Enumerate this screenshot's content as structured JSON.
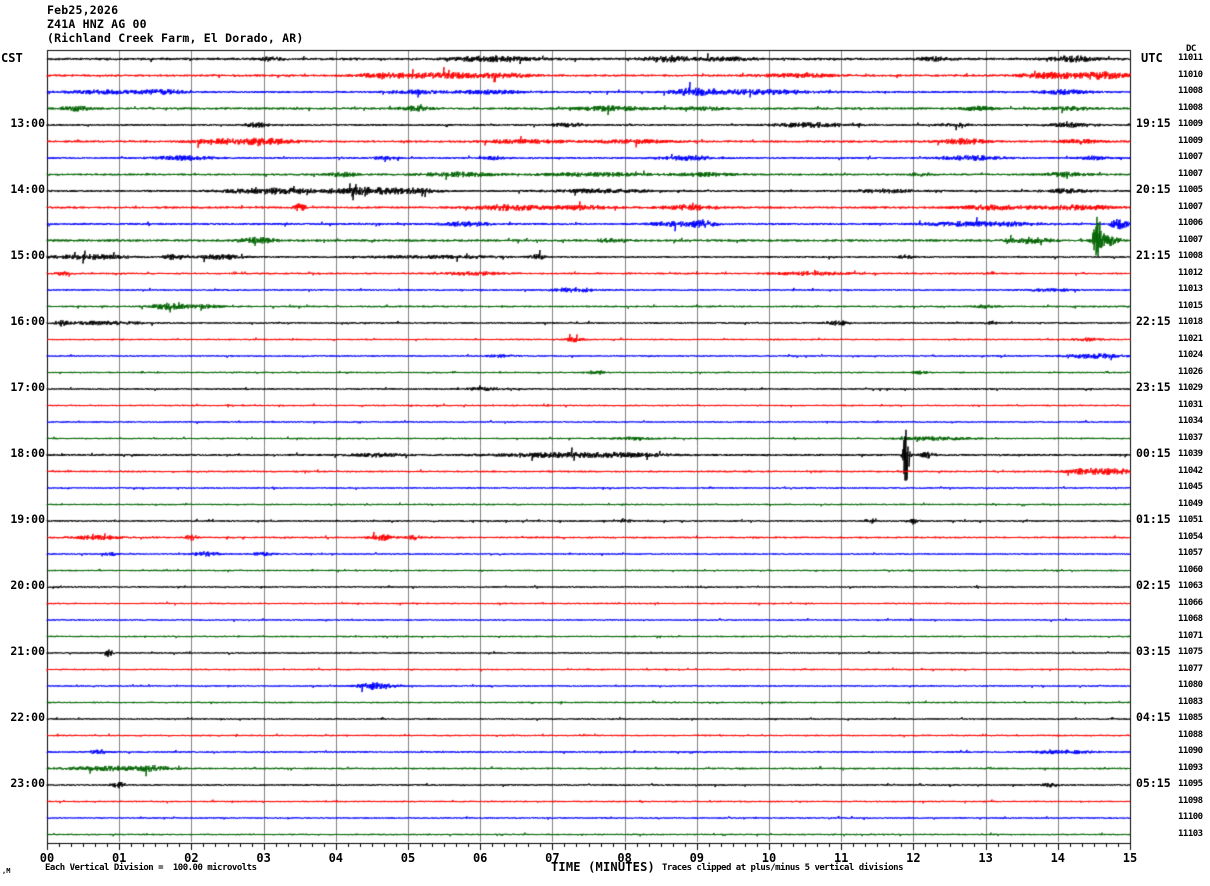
{
  "header": {
    "date": "Feb25,2026",
    "station": "Z41A HNZ AG 00",
    "location": "(Richland Creek Farm, El Dorado, AR)"
  },
  "axes": {
    "left_label": "CST",
    "right_label": "UTC",
    "dc_label": "DC",
    "x_title": "TIME (MINUTES)",
    "x_ticks": [
      "00",
      "01",
      "02",
      "03",
      "04",
      "05",
      "06",
      "07",
      "08",
      "09",
      "10",
      "11",
      "12",
      "13",
      "14",
      "15"
    ]
  },
  "footer": {
    "scale_note": "Each Vertical Division =  100.00 microvolts",
    "clip_note": "Traces clipped at plus/minus 5 vertical divisions",
    "corner_mark": ",M"
  },
  "colors": {
    "background": "#ffffff",
    "grid": "#808080",
    "border": "#000000",
    "text": "#000000",
    "trace_map": {
      "black": "#000000",
      "red": "#ff0000",
      "blue": "#0000ff",
      "green": "#006400"
    }
  },
  "chart_data": {
    "type": "line",
    "subtype": "helicorder-seismogram",
    "title": "Feb25,2026 Z41A HNZ AG 00 (Richland Creek Farm, El Dorado, AR)",
    "xlabel": "TIME (MINUTES)",
    "x_range_minutes": [
      0,
      15
    ],
    "x_major_tick_minutes": 1,
    "x_minor_tick_seconds": 10,
    "minutes_per_row": 15,
    "left_timezone": "CST",
    "right_timezone": "UTC",
    "vertical_division_microvolts": 100.0,
    "clip_divisions": 5,
    "grid": "vertical-minute-lines",
    "trace_color_cycle": [
      "black",
      "red",
      "blue",
      "green"
    ],
    "rows": [
      {
        "color": "black",
        "dc": 11011,
        "base": 1.3,
        "events": [
          [
            3.1,
            1.5,
            0.15
          ],
          [
            6.2,
            2.5,
            0.5
          ],
          [
            8.6,
            2.5,
            0.3
          ],
          [
            9.4,
            1.5,
            0.4
          ],
          [
            12.3,
            1.5,
            0.2
          ],
          [
            14.2,
            2.5,
            0.3
          ]
        ]
      },
      {
        "color": "red",
        "dc": 11010,
        "base": 1.1,
        "events": [
          [
            4.7,
            2,
            0.4
          ],
          [
            5.6,
            2.5,
            0.6
          ],
          [
            6.4,
            1.5,
            0.3
          ],
          [
            10.4,
            1.5,
            0.5
          ],
          [
            13.9,
            2.5,
            0.4
          ],
          [
            14.6,
            3,
            0.4
          ]
        ]
      },
      {
        "color": "blue",
        "dc": 11008,
        "base": 1.1,
        "events": [
          [
            0.8,
            1.5,
            0.5
          ],
          [
            1.6,
            2,
            0.3
          ],
          [
            5.1,
            1.5,
            0.3
          ],
          [
            6.1,
            1.5,
            0.5
          ],
          [
            8.9,
            3,
            0.25
          ],
          [
            9.8,
            2,
            0.8
          ],
          [
            14.1,
            2,
            0.3
          ]
        ]
      },
      {
        "color": "green",
        "dc": 11008,
        "base": 1.1,
        "events": [
          [
            0.4,
            2,
            0.2
          ],
          [
            5.1,
            2,
            0.2
          ],
          [
            7.8,
            2,
            0.5
          ],
          [
            9.1,
            1.5,
            0.3
          ],
          [
            12.9,
            2,
            0.2
          ],
          [
            14.2,
            1.5,
            0.3
          ]
        ]
      },
      {
        "cst": "13:00",
        "utc": "19:15",
        "color": "black",
        "dc": 11009,
        "base": 1.0,
        "events": [
          [
            2.9,
            2,
            0.15
          ],
          [
            7.2,
            1.5,
            0.2
          ],
          [
            10.6,
            2,
            0.5
          ],
          [
            12.6,
            1.5,
            0.2
          ],
          [
            14.2,
            2,
            0.3
          ]
        ]
      },
      {
        "color": "red",
        "dc": 11009,
        "base": 1.1,
        "events": [
          [
            2.3,
            2.5,
            0.3
          ],
          [
            3.0,
            3,
            0.4
          ],
          [
            6.6,
            1.5,
            0.6
          ],
          [
            8.1,
            1.5,
            0.5
          ],
          [
            12.7,
            2.5,
            0.3
          ],
          [
            14.3,
            2,
            0.25
          ]
        ]
      },
      {
        "color": "blue",
        "dc": 11007,
        "base": 1.0,
        "events": [
          [
            1.9,
            2,
            0.4
          ],
          [
            4.7,
            1.5,
            0.15
          ],
          [
            6.2,
            1.5,
            0.15
          ],
          [
            8.9,
            2,
            0.4
          ],
          [
            12.8,
            2,
            0.4
          ],
          [
            14.5,
            1.5,
            0.2
          ]
        ]
      },
      {
        "color": "green",
        "dc": 11007,
        "base": 1.0,
        "events": [
          [
            4.1,
            2,
            0.2
          ],
          [
            5.7,
            2,
            0.5
          ],
          [
            7.6,
            1.5,
            0.8
          ],
          [
            9.1,
            1.5,
            0.4
          ],
          [
            12.1,
            1.5,
            0.15
          ],
          [
            14.1,
            2,
            0.3
          ]
        ]
      },
      {
        "cst": "14:00",
        "utc": "20:15",
        "color": "black",
        "dc": 11005,
        "base": 1.1,
        "events": [
          [
            3.1,
            2.5,
            0.6
          ],
          [
            4.4,
            3,
            0.5
          ],
          [
            5.1,
            2,
            0.3
          ],
          [
            7.7,
            1.5,
            0.6
          ],
          [
            11.6,
            1.5,
            0.4
          ],
          [
            14.1,
            1.5,
            0.3
          ]
        ]
      },
      {
        "color": "red",
        "dc": 11007,
        "base": 1.1,
        "events": [
          [
            3.5,
            3.5,
            0.08
          ],
          [
            6.4,
            2.5,
            0.5
          ],
          [
            7.4,
            2,
            0.4
          ],
          [
            8.9,
            2,
            0.4
          ],
          [
            13.1,
            2,
            0.5
          ],
          [
            14.3,
            2,
            0.5
          ]
        ]
      },
      {
        "color": "blue",
        "dc": 11006,
        "base": 1.1,
        "events": [
          [
            5.8,
            2,
            0.3
          ],
          [
            8.7,
            2,
            0.3
          ],
          [
            9.1,
            3.5,
            0.15
          ],
          [
            12.7,
            2,
            0.5
          ],
          [
            13.4,
            1.5,
            0.3
          ],
          [
            14.85,
            4.5,
            0.12
          ]
        ]
      },
      {
        "color": "green",
        "dc": 11007,
        "base": 1.2,
        "events": [
          [
            2.9,
            2.5,
            0.25
          ],
          [
            7.8,
            1.5,
            0.2
          ],
          [
            13.6,
            2.5,
            0.3
          ],
          [
            14.55,
            22,
            0.06
          ],
          [
            14.7,
            5,
            0.15
          ]
        ]
      },
      {
        "cst": "15:00",
        "utc": "21:15",
        "color": "black",
        "dc": 11008,
        "base": 1.0,
        "events": [
          [
            0.6,
            2,
            0.5
          ],
          [
            1.75,
            3,
            0.12
          ],
          [
            2.4,
            2,
            0.3
          ],
          [
            5.4,
            1.2,
            0.8
          ],
          [
            6.8,
            2,
            0.1
          ],
          [
            11.9,
            1.5,
            0.1
          ]
        ]
      },
      {
        "color": "red",
        "dc": 11012,
        "base": 0.9,
        "events": [
          [
            0.2,
            2,
            0.1
          ],
          [
            5.9,
            1.5,
            0.4
          ],
          [
            10.6,
            1.5,
            0.5
          ]
        ]
      },
      {
        "color": "blue",
        "dc": 11013,
        "base": 0.9,
        "events": [
          [
            7.3,
            2,
            0.3
          ],
          [
            13.9,
            1.2,
            0.3
          ]
        ]
      },
      {
        "color": "green",
        "dc": 11015,
        "base": 0.9,
        "events": [
          [
            1.7,
            3,
            0.25
          ],
          [
            2.2,
            1.5,
            0.2
          ],
          [
            13.0,
            1.5,
            0.15
          ]
        ]
      },
      {
        "cst": "16:00",
        "utc": "22:15",
        "color": "black",
        "dc": 11018,
        "base": 0.9,
        "events": [
          [
            0.2,
            2.5,
            0.08
          ],
          [
            0.8,
            1.5,
            0.5
          ],
          [
            10.95,
            2,
            0.15
          ],
          [
            13.1,
            1.5,
            0.1
          ]
        ]
      },
      {
        "color": "red",
        "dc": 11021,
        "base": 0.8,
        "events": [
          [
            7.3,
            2,
            0.12
          ],
          [
            14.4,
            1.5,
            0.2
          ]
        ]
      },
      {
        "color": "blue",
        "dc": 11024,
        "base": 0.8,
        "events": [
          [
            6.3,
            1.2,
            0.2
          ],
          [
            14.5,
            2,
            0.4
          ]
        ]
      },
      {
        "color": "green",
        "dc": 11026,
        "base": 0.8,
        "events": [
          [
            7.6,
            2,
            0.12
          ],
          [
            12.1,
            1.5,
            0.1
          ]
        ]
      },
      {
        "cst": "17:00",
        "utc": "23:15",
        "color": "black",
        "dc": 11029,
        "base": 0.9,
        "events": [
          [
            6.1,
            1.2,
            0.3
          ]
        ]
      },
      {
        "color": "red",
        "dc": 11031,
        "base": 0.8,
        "events": []
      },
      {
        "color": "blue",
        "dc": 11034,
        "base": 0.8,
        "events": []
      },
      {
        "color": "green",
        "dc": 11037,
        "base": 0.8,
        "events": [
          [
            8.1,
            1.2,
            0.3
          ],
          [
            12.3,
            1.5,
            0.5
          ]
        ]
      },
      {
        "cst": "18:00",
        "utc": "00:15",
        "color": "black",
        "dc": 11039,
        "base": 1.1,
        "events": [
          [
            4.6,
            1.5,
            0.3
          ],
          [
            7.1,
            2,
            0.8
          ],
          [
            8.1,
            1.5,
            0.5
          ],
          [
            11.9,
            38,
            0.035
          ],
          [
            12.2,
            2.5,
            0.1
          ]
        ]
      },
      {
        "color": "red",
        "dc": 11042,
        "base": 0.9,
        "events": [
          [
            14.45,
            3,
            0.3
          ],
          [
            14.85,
            2,
            0.2
          ]
        ]
      },
      {
        "color": "blue",
        "dc": 11045,
        "base": 0.8,
        "events": []
      },
      {
        "color": "green",
        "dc": 11049,
        "base": 0.8,
        "events": []
      },
      {
        "cst": "19:00",
        "utc": "01:15",
        "color": "black",
        "dc": 11051,
        "base": 0.9,
        "events": [
          [
            8.0,
            2,
            0.08
          ],
          [
            11.4,
            2.5,
            0.06
          ],
          [
            12.0,
            2,
            0.08
          ]
        ]
      },
      {
        "color": "red",
        "dc": 11054,
        "base": 0.9,
        "events": [
          [
            0.7,
            2,
            0.3
          ],
          [
            2.0,
            2.5,
            0.08
          ],
          [
            4.65,
            3,
            0.15
          ],
          [
            5.1,
            2,
            0.1
          ]
        ]
      },
      {
        "color": "blue",
        "dc": 11057,
        "base": 0.8,
        "events": [
          [
            0.9,
            1.5,
            0.1
          ],
          [
            2.2,
            2,
            0.2
          ],
          [
            3.0,
            1.5,
            0.15
          ]
        ]
      },
      {
        "color": "green",
        "dc": 11060,
        "base": 0.8,
        "events": []
      },
      {
        "cst": "20:00",
        "utc": "02:15",
        "color": "black",
        "dc": 11063,
        "base": 0.8,
        "events": []
      },
      {
        "color": "red",
        "dc": 11066,
        "base": 0.8,
        "events": []
      },
      {
        "color": "blue",
        "dc": 11068,
        "base": 0.8,
        "events": []
      },
      {
        "color": "green",
        "dc": 11071,
        "base": 0.8,
        "events": []
      },
      {
        "cst": "21:00",
        "utc": "03:15",
        "color": "black",
        "dc": 11075,
        "base": 0.8,
        "events": [
          [
            0.85,
            3.5,
            0.06
          ]
        ]
      },
      {
        "color": "red",
        "dc": 11077,
        "base": 0.8,
        "events": []
      },
      {
        "color": "blue",
        "dc": 11080,
        "base": 0.8,
        "events": [
          [
            4.55,
            3.5,
            0.25
          ]
        ]
      },
      {
        "color": "green",
        "dc": 11083,
        "base": 0.8,
        "events": []
      },
      {
        "cst": "22:00",
        "utc": "04:15",
        "color": "black",
        "dc": 11085,
        "base": 0.8,
        "events": []
      },
      {
        "color": "red",
        "dc": 11088,
        "base": 0.8,
        "events": []
      },
      {
        "color": "blue",
        "dc": 11090,
        "base": 0.9,
        "events": [
          [
            0.7,
            1.5,
            0.1
          ],
          [
            14.1,
            1.5,
            0.4
          ]
        ]
      },
      {
        "color": "green",
        "dc": 11093,
        "base": 0.9,
        "events": [
          [
            0.9,
            2,
            0.6
          ],
          [
            1.5,
            2,
            0.2
          ]
        ]
      },
      {
        "cst": "23:00",
        "utc": "05:15",
        "color": "black",
        "dc": 11095,
        "base": 0.9,
        "events": [
          [
            1.0,
            2.5,
            0.1
          ],
          [
            13.9,
            2,
            0.1
          ]
        ]
      },
      {
        "color": "red",
        "dc": 11098,
        "base": 0.8,
        "events": []
      },
      {
        "color": "blue",
        "dc": 11100,
        "base": 0.8,
        "events": []
      },
      {
        "color": "green",
        "dc": 11103,
        "base": 0.8,
        "events": []
      }
    ]
  }
}
